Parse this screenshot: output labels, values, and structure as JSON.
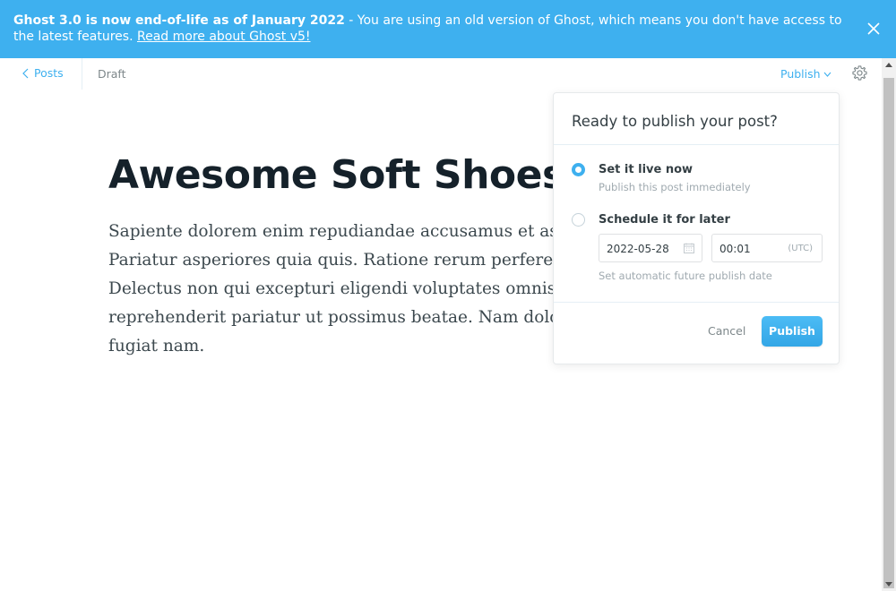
{
  "banner": {
    "bold_text": "Ghost 3.0 is now end-of-life as of January 2022",
    "message": " - You are using an old version of Ghost, which means you don't have access to the latest features. ",
    "link_text": "Read more about Ghost v5!",
    "close_icon": "close-icon",
    "background_color": "#3eb0ef"
  },
  "header": {
    "back_label": "Posts",
    "status": "Draft",
    "publish_label": "Publish",
    "settings_icon": "gear-icon"
  },
  "post": {
    "title": "Awesome Soft Shoes",
    "body_lines": [
      "Sapiente dolorem enim repudiandae accusamus et assumenda quia",
      "Pariatur asperiores quia quis. Ratione rerum perferendis sint.",
      "Delectus non qui excepturi eligendi voluptates omnis dolores",
      "reprehenderit pariatur ut possimus beatae. Nam dolorem itaque",
      "fugiat nam."
    ]
  },
  "publish_menu": {
    "heading": "Ready to publish your post?",
    "options": [
      {
        "title": "Set it live now",
        "description": "Publish this post immediately",
        "selected": true
      },
      {
        "title": "Schedule it for later",
        "description": "Set automatic future publish date",
        "selected": false
      }
    ],
    "date_value": "2022-05-28",
    "time_value": "00:01",
    "timezone": "(UTC)",
    "cancel_label": "Cancel",
    "publish_button_label": "Publish",
    "accent_color": "#3eb0ef"
  }
}
